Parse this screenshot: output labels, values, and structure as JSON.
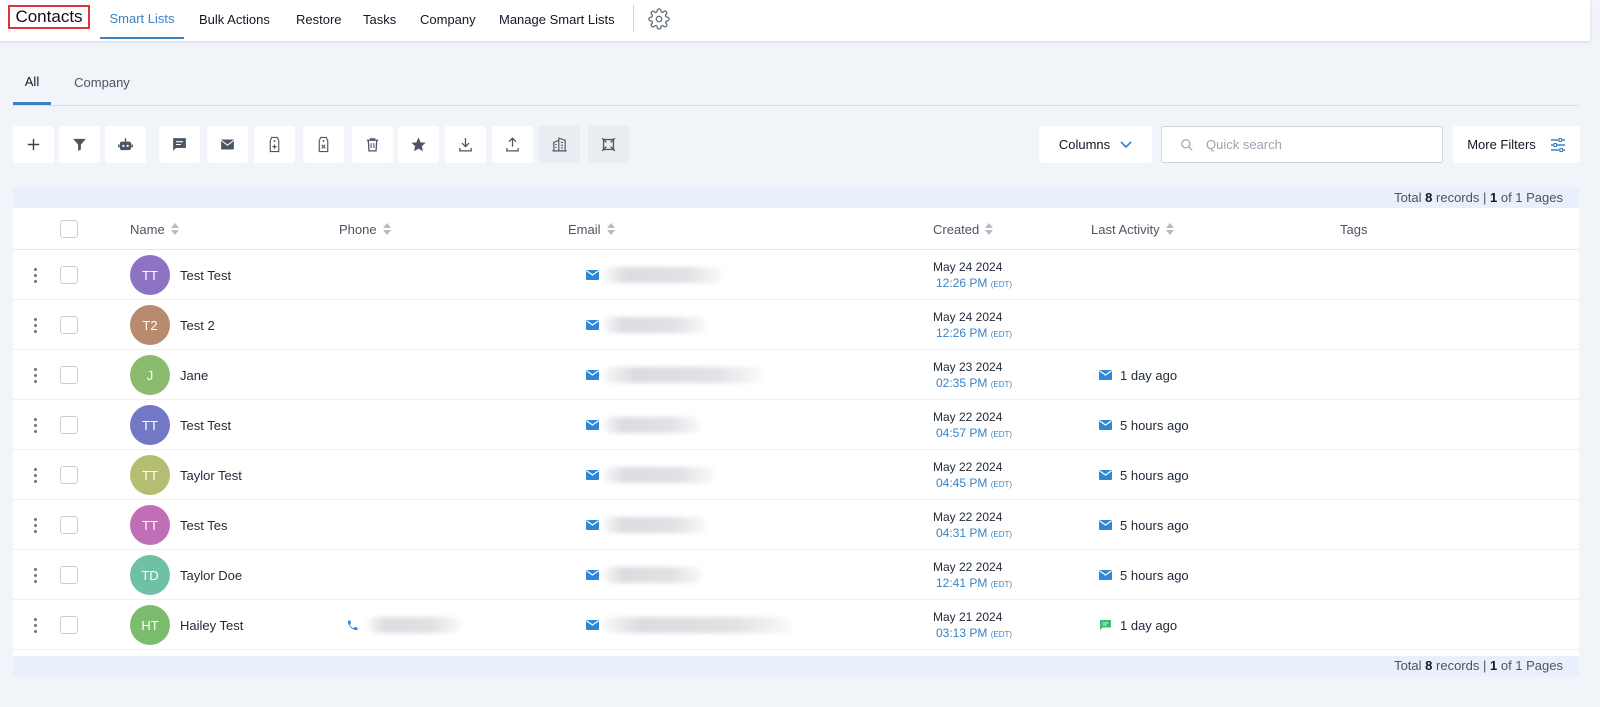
{
  "nav": {
    "brand": "Contacts",
    "items": [
      "Smart Lists",
      "Bulk Actions",
      "Restore",
      "Tasks",
      "Company",
      "Manage Smart Lists"
    ]
  },
  "subtabs": [
    "All",
    "Company"
  ],
  "toolbar": {
    "icons": [
      "plus-icon",
      "filter-icon",
      "robot-icon",
      "message-icon",
      "email-icon",
      "tag-add-icon",
      "tag-remove-icon",
      "trash-icon",
      "star-icon",
      "download-icon",
      "upload-icon",
      "building-icon",
      "merge-icon"
    ],
    "columns_label": "Columns",
    "search_placeholder": "Quick search",
    "more_filters_label": "More Filters"
  },
  "pagination": {
    "prefix": "Total",
    "records": "8",
    "records_label": "records |",
    "page": "1",
    "pages_text": "of 1 Pages"
  },
  "table": {
    "headers": {
      "name": "Name",
      "phone": "Phone",
      "email": "Email",
      "created": "Created",
      "last_activity": "Last Activity",
      "tags": "Tags"
    },
    "rows": [
      {
        "initials": "TT",
        "color": "#8e72c4",
        "name": "Test Test",
        "date": "May 24 2024",
        "time": "12:26 PM",
        "tz": "(EDT)",
        "activity": "",
        "activity_icon": "",
        "email_blur_w": 120,
        "phone": false
      },
      {
        "initials": "T2",
        "color": "#b88a6e",
        "name": "Test 2",
        "date": "May 24 2024",
        "time": "12:26 PM",
        "tz": "(EDT)",
        "activity": "",
        "activity_icon": "",
        "email_blur_w": 104,
        "phone": false
      },
      {
        "initials": "J",
        "color": "#8bbc6d",
        "name": "Jane",
        "date": "May 23 2024",
        "time": "02:35 PM",
        "tz": "(EDT)",
        "activity": "1 day ago",
        "activity_icon": "email",
        "email_blur_w": 160,
        "phone": false
      },
      {
        "initials": "TT",
        "color": "#7278c4",
        "name": "Test Test",
        "date": "May 22 2024",
        "time": "04:57 PM",
        "tz": "(EDT)",
        "activity": "5 hours ago",
        "activity_icon": "email",
        "email_blur_w": 98,
        "phone": false
      },
      {
        "initials": "TT",
        "color": "#b4bd72",
        "name": "Taylor Test",
        "date": "May 22 2024",
        "time": "04:45 PM",
        "tz": "(EDT)",
        "activity": "5 hours ago",
        "activity_icon": "email",
        "email_blur_w": 112,
        "phone": false
      },
      {
        "initials": "TT",
        "color": "#c06fb6",
        "name": "Test Tes",
        "date": "May 22 2024",
        "time": "04:31 PM",
        "tz": "(EDT)",
        "activity": "5 hours ago",
        "activity_icon": "email",
        "email_blur_w": 104,
        "phone": false
      },
      {
        "initials": "TD",
        "color": "#6fc1a4",
        "name": "Taylor Doe",
        "date": "May 22 2024",
        "time": "12:41 PM",
        "tz": "(EDT)",
        "activity": "5 hours ago",
        "activity_icon": "email",
        "email_blur_w": 100,
        "phone": false
      },
      {
        "initials": "HT",
        "color": "#7cbc6e",
        "name": "Hailey Test",
        "date": "May 21 2024",
        "time": "03:13 PM",
        "tz": "(EDT)",
        "activity": "1 day ago",
        "activity_icon": "sms",
        "email_blur_w": 190,
        "phone": true
      }
    ]
  },
  "colors": {
    "accent": "#3b82c4",
    "brand_border": "#e0323a",
    "activity_email": "#2f86d6",
    "activity_sms": "#2fbf71"
  }
}
